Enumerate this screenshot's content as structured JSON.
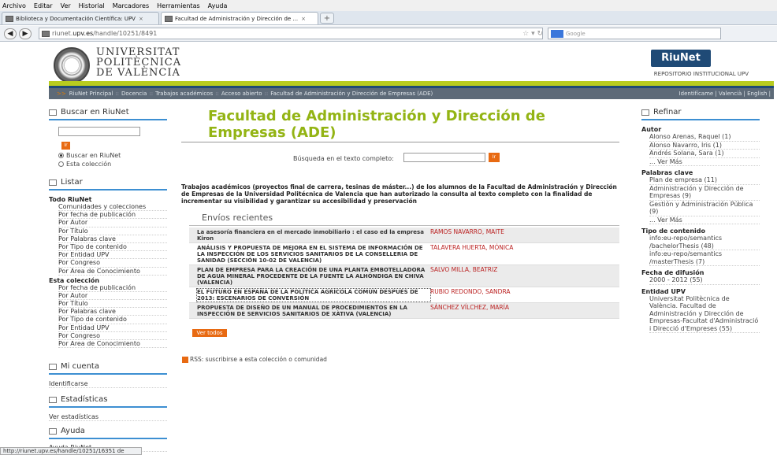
{
  "browser": {
    "menu": [
      "Archivo",
      "Editar",
      "Ver",
      "Historial",
      "Marcadores",
      "Herramientas",
      "Ayuda"
    ],
    "tabs": [
      {
        "label": "Biblioteca y Documentación Científica: UPV"
      },
      {
        "label": "Facultad de Administración y Dirección de ..."
      }
    ],
    "url_prefix": "riunet.",
    "url_host": "upv.es",
    "url_path": "/handle/10251/8491",
    "search_placeholder": "Google",
    "status": "http://riunet.upv.es/handle/10251/16351 de"
  },
  "header": {
    "univ_line1": "UNIVERSITAT",
    "univ_line2": "POLITÈCNICA",
    "univ_line3": "DE VALÈNCIA",
    "brand": "RiuNet",
    "brand_sub": "REPOSITORIO INSTITUCIONAL UPV"
  },
  "breadcrumb": {
    "items": [
      "RiuNet Principal",
      "Docencia",
      "Trabajos académicos",
      "Acceso abierto",
      "Facultad de Administración y Dirección de Empresas (ADE)"
    ],
    "right": "Identifícame  | Valencià | English |"
  },
  "left": {
    "search_title": "Buscar en RiuNet",
    "go": "Ir",
    "radio1": "Buscar en RiuNet",
    "radio2": "Esta colección",
    "listar_title": "Listar",
    "todo_title": "Todo RiuNet",
    "todo_links": [
      "Comunidades y colecciones",
      "Por fecha de publicación",
      "Por Autor",
      "Por Título",
      "Por Palabras clave",
      "Por Tipo de contenido",
      "Por Entidad UPV",
      "Por Congreso",
      "Por Area de Conocimiento"
    ],
    "esta_title": "Esta colección",
    "esta_links": [
      "Por fecha de publicación",
      "Por Autor",
      "Por Título",
      "Por Palabras clave",
      "Por Tipo de contenido",
      "Por Entidad UPV",
      "Por Congreso",
      "Por Area de Conocimiento"
    ],
    "micuenta_title": "Mi cuenta",
    "micuenta_link": "Identificarse",
    "stats_title": "Estadísticas",
    "stats_link": "Ver estadísticas",
    "ayuda_title": "Ayuda",
    "ayuda_link": "Ayuda RiuNet"
  },
  "main": {
    "title": "Facultad de Administración y Dirección de Empresas (ADE)",
    "fulltext_label": "Búsqueda en el texto completo:",
    "go": "Ir",
    "description": "Trabajos académicos (proyectos final de carrera, tesinas de máster...) de los alumnos de la Facultad de Administración y Dirección de Empresas de la Universidad Politécnica de Valencia que han autorizado la consulta al texto completo con la finalidad de incrementar su visibilidad y garantizar su accesibilidad y preservación",
    "recent_title": "Envíos recientes",
    "items": [
      {
        "title": "La asesoría financiera en el mercado inmobiliario : el caso ed la empresa Kiron",
        "author": "RAMOS NAVARRO, MAITE"
      },
      {
        "title": "ANÁLISIS Y PROPUESTA DE MEJORA EN EL SISTEMA DE INFORMACIÓN DE LA INSPECCIÓN DE LOS SERVICIOS SANITARIOS DE LA CONSELLERIA DE SANIDAD (SECCIÓN 10-02 DE VALENCIA)",
        "author": "TALAVERA HUERTA, MÓNICA"
      },
      {
        "title": "PLAN DE EMPRESA PARA LA CREACIÓN DE UNA PLANTA EMBOTELLADORA DE AGUA MINERAL PROCEDENTE DE LA FUENTE LA ALHÓNDIGA EN CHIVA (VALENCIA)",
        "author": "SALVO MILLA, BEATRIZ"
      },
      {
        "title": "EL FUTURO EN ESPAÑA DE LA POLÍTICA AGRÍCOLA COMÚN DESPUÉS DE 2013: ESCENARIOS DE CONVERSIÓN",
        "author": "RUBIO REDONDO, SANDRA"
      },
      {
        "title": "PROPUESTA DE DISEÑO DE UN MANUAL DE PROCEDIMIENTOS EN LA INSPECCIÓN DE SERVICIOS SANITARIOS DE XÀTIVA (VALENCIA)",
        "author": "SÁNCHEZ VÍLCHEZ, MARÍA"
      }
    ],
    "ver_todos": "Ver todos",
    "rss": "RSS: suscribirse a esta colección o comunidad"
  },
  "right": {
    "title": "Refinar",
    "autor_h": "Autor",
    "autor": [
      "Alonso Arenas, Raquel (1)",
      "Alonso Navarro, Iris (1)",
      "Andrés Solana, Sara (1)",
      "... Ver Más"
    ],
    "pal_h": "Palabras clave",
    "pal": [
      "Plan de empresa (11)",
      "Administración y Dirección de Empresas (9)",
      "Gestión y Administración Pública (9)",
      "... Ver Más"
    ],
    "tipo_h": "Tipo de contenido",
    "tipo": [
      "info:eu-repo/semantics /bachelorThesis (48)",
      "info:eu-repo/semantics /masterThesis (7)"
    ],
    "fecha_h": "Fecha de difusión",
    "fecha": [
      "2000 - 2012 (55)"
    ],
    "entidad_h": "Entidad UPV",
    "entidad": [
      "Universitat Politècnica de València. Facultad de Administración y Dirección de Empresas-Facultat d'Administració i Direcció d'Empreses (55)"
    ]
  }
}
